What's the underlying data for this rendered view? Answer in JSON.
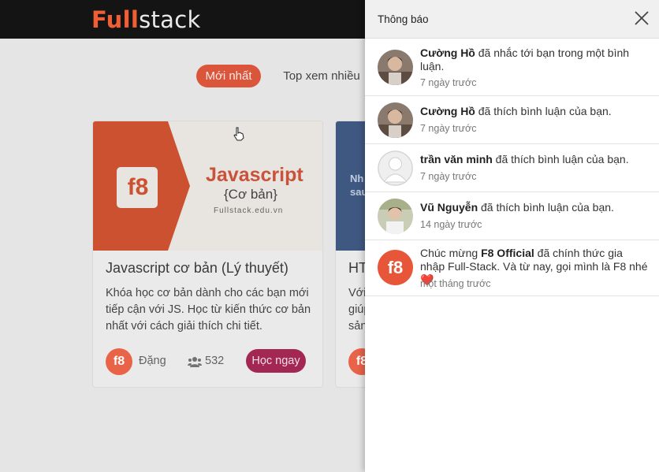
{
  "header": {
    "logo_part1": "Full",
    "logo_part2": "stack"
  },
  "tabs": [
    {
      "label": "Mới nhất",
      "active": true
    },
    {
      "label": "Top xem nhiều",
      "active": false
    }
  ],
  "courses": [
    {
      "thumb_title": "Javascript",
      "thumb_subtitle": "{Cơ bản}",
      "thumb_url": "Fullstack.edu.vn",
      "thumb_logo": "f8",
      "title": "Javascript cơ bản (Lý thuyết)",
      "description": "Khóa học cơ bản dành cho các bạn mới tiếp cận với JS. Học từ kiến thức cơ bản nhất với cách giải thích chi tiết.",
      "author": "Đặng",
      "students": "532",
      "button": "Học ngay"
    },
    {
      "thumb_text_1": "Nh",
      "thumb_text_2": "sau",
      "title": "HT",
      "desc_1": "Với",
      "desc_2": "giúp",
      "desc_3": "sản",
      "avatar": "f8"
    }
  ],
  "panel": {
    "title": "Thông báo",
    "notifications": [
      {
        "name": "Cường Hồ",
        "message": " đã nhắc tới bạn trong một bình luận.",
        "time": "7 ngày trước",
        "avatar": "photo-icon"
      },
      {
        "name": "Cường Hồ",
        "message": " đã thích bình luận của bạn.",
        "time": "7 ngày trước",
        "avatar": "photo-icon"
      },
      {
        "name": "trần văn minh",
        "message": " đã thích bình luận của bạn.",
        "time": "7 ngày trước",
        "avatar": "default-user-icon"
      },
      {
        "name": "Vũ Nguyễn",
        "message": " đã thích bình luận của bạn.",
        "time": "14 ngày trước",
        "avatar": "photo-icon"
      },
      {
        "prefix": "Chúc mừng ",
        "name": "F8 Official",
        "message": " đã chính thức gia nhập Full-Stack. Và từ nay, gọi mình là F8 nhé",
        "emoji": "❤️",
        "time": "một tháng trước",
        "avatar": "f8"
      }
    ]
  },
  "colors": {
    "brand": "#f05123",
    "tab_active": "#d8472a",
    "button": "#9b1545"
  }
}
